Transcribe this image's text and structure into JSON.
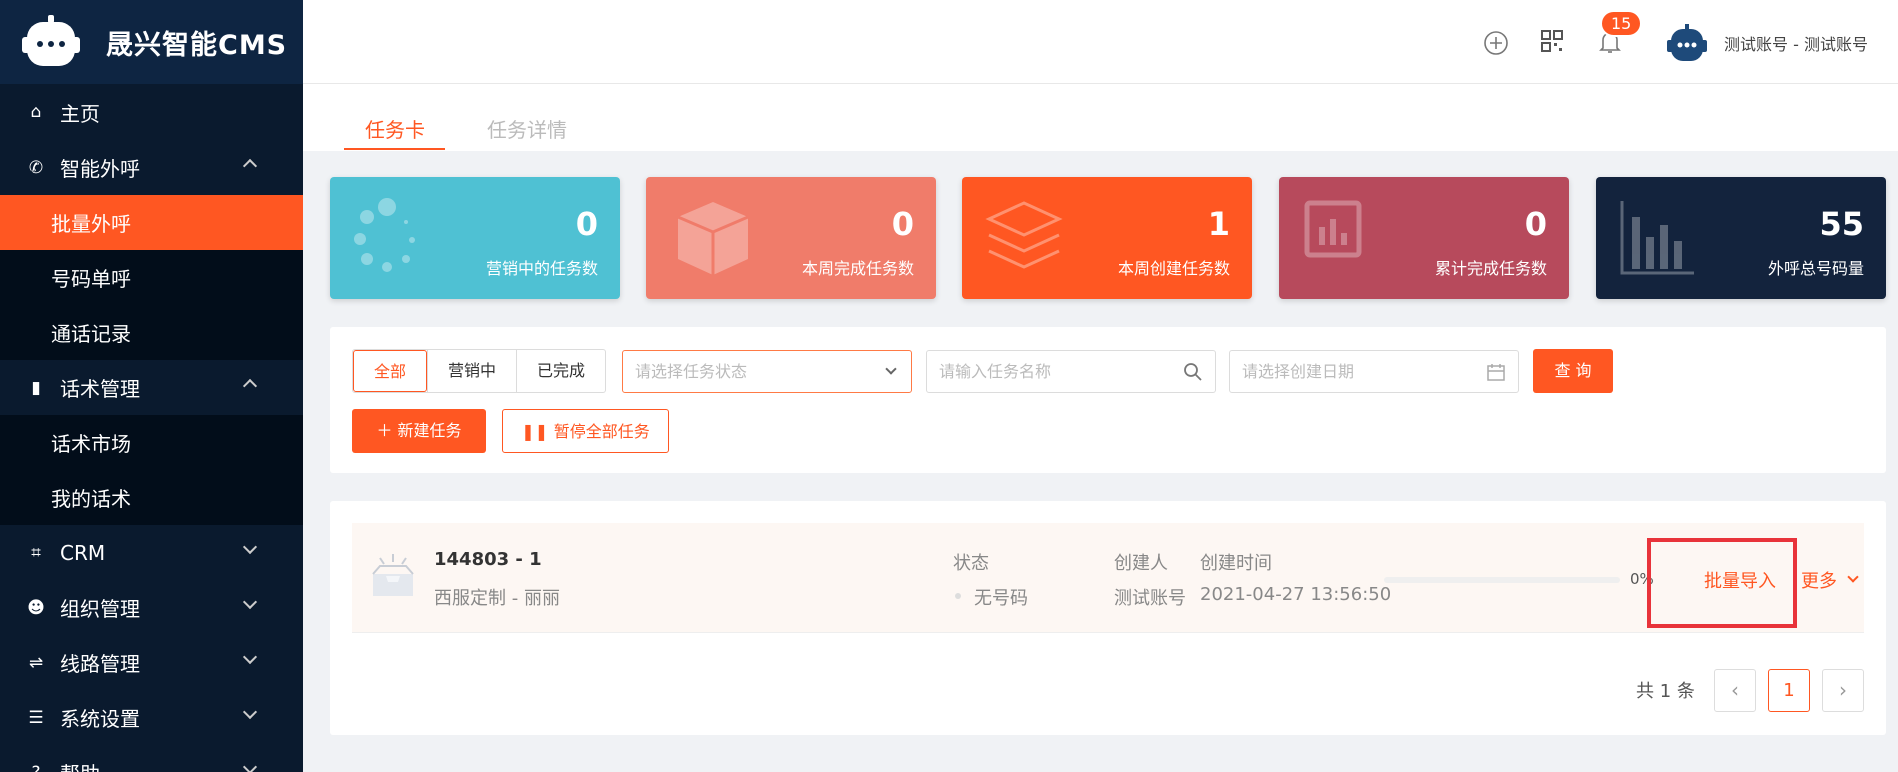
{
  "app": {
    "title": "晟兴智能CMS"
  },
  "sidebar": {
    "items": [
      {
        "label": "主页",
        "icon": "home-icon"
      },
      {
        "label": "智能外呼",
        "icon": "phone-icon"
      },
      {
        "label": "批量外呼"
      },
      {
        "label": "号码单呼"
      },
      {
        "label": "通话记录"
      },
      {
        "label": "话术管理",
        "icon": "book-icon"
      },
      {
        "label": "话术市场"
      },
      {
        "label": "我的话术"
      },
      {
        "label": "CRM",
        "icon": "crop-icon"
      },
      {
        "label": "组织管理",
        "icon": "users-icon"
      },
      {
        "label": "线路管理",
        "icon": "route-icon"
      },
      {
        "label": "系统设置",
        "icon": "sliders-icon"
      },
      {
        "label": "帮助",
        "icon": "help-icon"
      }
    ]
  },
  "header": {
    "notification_count": "15",
    "user_name": "测试账号 - 测试账号"
  },
  "tabs": [
    {
      "label": "任务卡"
    },
    {
      "label": "任务详情"
    }
  ],
  "stats": [
    {
      "value": "0",
      "label": "营销中的任务数",
      "color": "#4fc1d3"
    },
    {
      "value": "0",
      "label": "本周完成任务数",
      "color": "#f07c6a"
    },
    {
      "value": "1",
      "label": "本周创建任务数",
      "color": "#ff5722"
    },
    {
      "value": "0",
      "label": "累计完成任务数",
      "color": "#b74a5c"
    },
    {
      "value": "55",
      "label": "外呼总号码量",
      "color": "#13233d"
    }
  ],
  "filters": {
    "segments": [
      "全部",
      "营销中",
      "已完成"
    ],
    "status_placeholder": "请选择任务状态",
    "name_placeholder": "请输入任务名称",
    "date_placeholder": "请选择创建日期",
    "query_label": "查 询",
    "new_task_label": "新建任务",
    "pause_all_label": "暂停全部任务"
  },
  "task": {
    "id": "144803 - 1",
    "script": "西服定制 - 丽丽",
    "status_header": "状态",
    "status_value": "无号码",
    "creator_header": "创建人",
    "creator_value": "测试账号",
    "time_header": "创建时间",
    "time_value": "2021-04-27 13:56:50",
    "progress_label": "0%",
    "progress": 0,
    "import_label": "批量导入",
    "more_label": "更多"
  },
  "pagination": {
    "total": "共 1 条",
    "current": "1",
    "prev": "‹",
    "next": "›"
  }
}
